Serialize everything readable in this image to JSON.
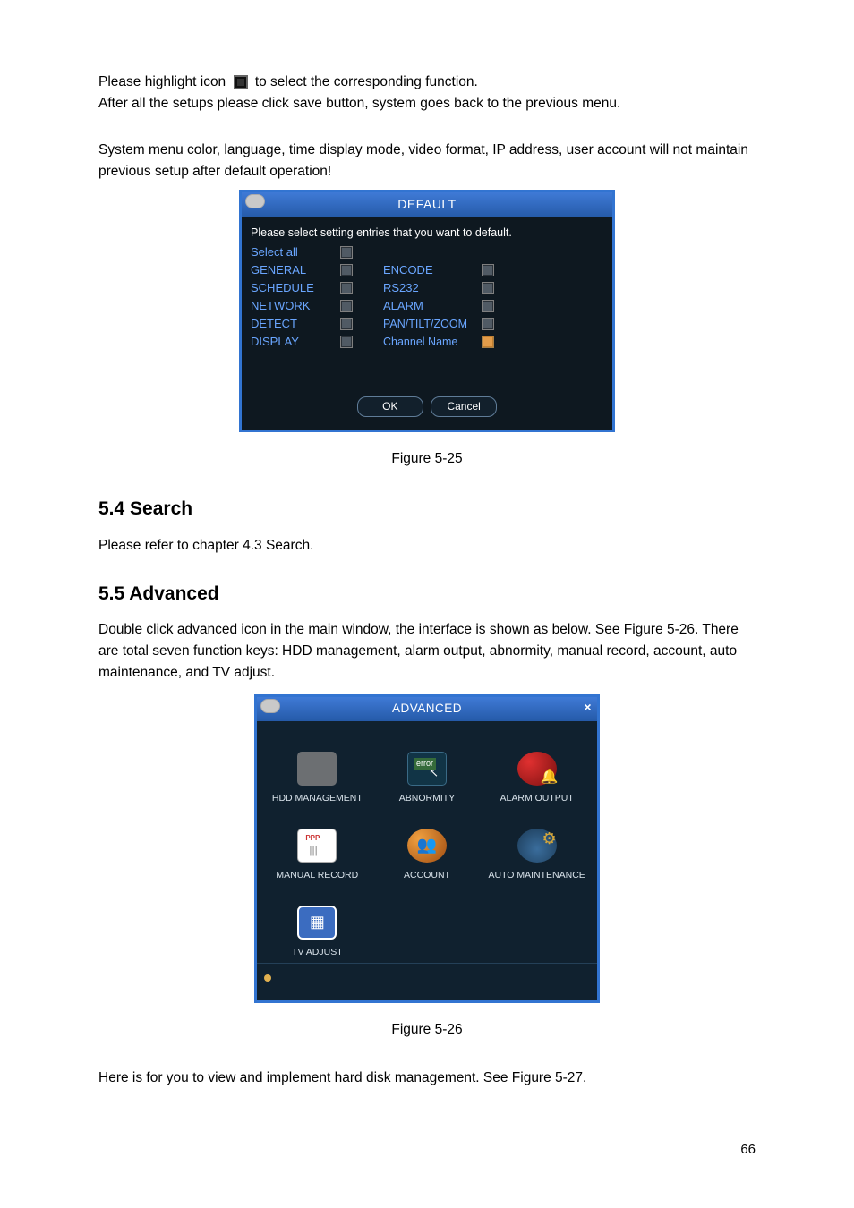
{
  "intro": {
    "line1a": "Please highlight icon ",
    "line1b": " to select the corresponding function.",
    "line2": "After all the setups please click save button, system goes back to the previous menu.",
    "paragraph": "System menu color, language, time display mode, video format, IP address, user account will not maintain previous setup after default operation!"
  },
  "default_dialog": {
    "title": "DEFAULT",
    "instruction": "Please select setting entries that you want to default.",
    "select_all": "Select all",
    "left_items": [
      "GENERAL",
      "SCHEDULE",
      "NETWORK",
      "DETECT",
      "DISPLAY"
    ],
    "right_items": [
      "ENCODE",
      "RS232",
      "ALARM",
      "PAN/TILT/ZOOM",
      "Channel Name"
    ],
    "ok": "OK",
    "cancel": "Cancel"
  },
  "captions": {
    "fig25": "Figure 5-25",
    "fig26": "Figure 5-26"
  },
  "sections": {
    "search_heading": "5.4  Search",
    "search_body": "Please refer to chapter 4.3 Search.",
    "advanced_heading": "5.5  Advanced",
    "advanced_body": "Double click advanced icon in the main window, the interface is shown as below. See Figure 5-26. There are total seven function keys: HDD management, alarm output, abnormity, manual record, account, auto maintenance, and TV adjust."
  },
  "advanced_dialog": {
    "title": "ADVANCED",
    "items": [
      "HDD MANAGEMENT",
      "ABNORMITY",
      "ALARM OUTPUT",
      "MANUAL RECORD",
      "ACCOUNT",
      "AUTO MAINTENANCE",
      "TV ADJUST"
    ]
  },
  "closing": "Here is for you to view and implement hard disk management. See Figure 5-27.",
  "page_number": "66"
}
